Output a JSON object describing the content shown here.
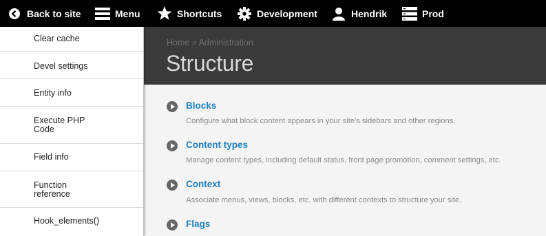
{
  "toolbar": {
    "back": "Back to site",
    "menu": "Menu",
    "shortcuts": "Shortcuts",
    "development": "Development",
    "user": "Hendrik",
    "environment": "Prod"
  },
  "sidebar": {
    "items": [
      {
        "label": "Clear cache"
      },
      {
        "label": "Devel settings"
      },
      {
        "label": "Entity info"
      },
      {
        "label": "Execute PHP\nCode"
      },
      {
        "label": "Field info"
      },
      {
        "label": "Function\nreference"
      },
      {
        "label": "Hook_elements()"
      }
    ]
  },
  "breadcrumb": {
    "home": "Home",
    "separator": "»",
    "current": "Administration"
  },
  "page_title": "Structure",
  "structure_items": [
    {
      "title": "Blocks",
      "description": "Configure what block content appears in your site's sidebars and other regions."
    },
    {
      "title": "Content types",
      "description": "Manage content types, including default status, front page promotion, comment settings, etc."
    },
    {
      "title": "Context",
      "description": "Associate menus, views, blocks, etc. with different contexts to structure your site."
    },
    {
      "title": "Flags",
      "description": ""
    }
  ],
  "colors": {
    "toolbar_bg": "#000000",
    "header_bg": "#3b3b3b",
    "content_bg": "#f4f4f4",
    "link": "#1e7fc1",
    "description": "#8a8a8a"
  }
}
